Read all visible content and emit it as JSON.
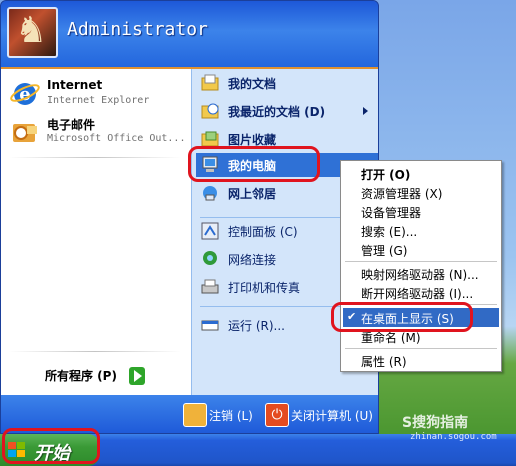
{
  "header": {
    "username": "Administrator"
  },
  "left_column": {
    "pinned": [
      {
        "title": "Internet",
        "subtitle": "Internet Explorer",
        "icon": "internet-explorer-icon"
      },
      {
        "title": "电子邮件",
        "subtitle": "Microsoft Office Out...",
        "icon": "outlook-icon"
      }
    ],
    "all_programs": "所有程序 (P)"
  },
  "right_column": {
    "items": [
      {
        "label": "我的文档",
        "icon": "my-documents-icon"
      },
      {
        "label": "我最近的文档 (D)",
        "icon": "recent-documents-icon"
      },
      {
        "label": "图片收藏",
        "icon": "my-pictures-icon"
      },
      {
        "label": "我的电脑",
        "icon": "my-computer-icon"
      },
      {
        "label": "网上邻居",
        "icon": "network-places-icon"
      },
      {
        "label": "控制面板 (C)",
        "icon": "control-panel-icon"
      },
      {
        "label": "网络连接",
        "icon": "network-connections-icon"
      },
      {
        "label": "打印机和传真",
        "icon": "printers-icon"
      },
      {
        "label": "运行 (R)...",
        "icon": "run-icon"
      }
    ]
  },
  "footer": {
    "logoff": "注销 (L)",
    "shutdown": "关闭计算机 (U)"
  },
  "taskbar": {
    "start_label": "开始"
  },
  "context_menu": {
    "items": [
      "打开 (O)",
      "资源管理器 (X)",
      "设备管理器",
      "搜索 (E)...",
      "管理 (G)",
      "映射网络驱动器 (N)...",
      "断开网络驱动器 (I)...",
      "在桌面上显示 (S)",
      "重命名 (M)",
      "属性 (R)"
    ]
  },
  "watermark": {
    "brand": "S搜狗指南",
    "url": "zhinan.sogou.com"
  },
  "colors": {
    "accent": "#2c61c9",
    "highlight": "#316ac5",
    "annotation": "#e0141e",
    "start_green": "#3a9a36"
  }
}
